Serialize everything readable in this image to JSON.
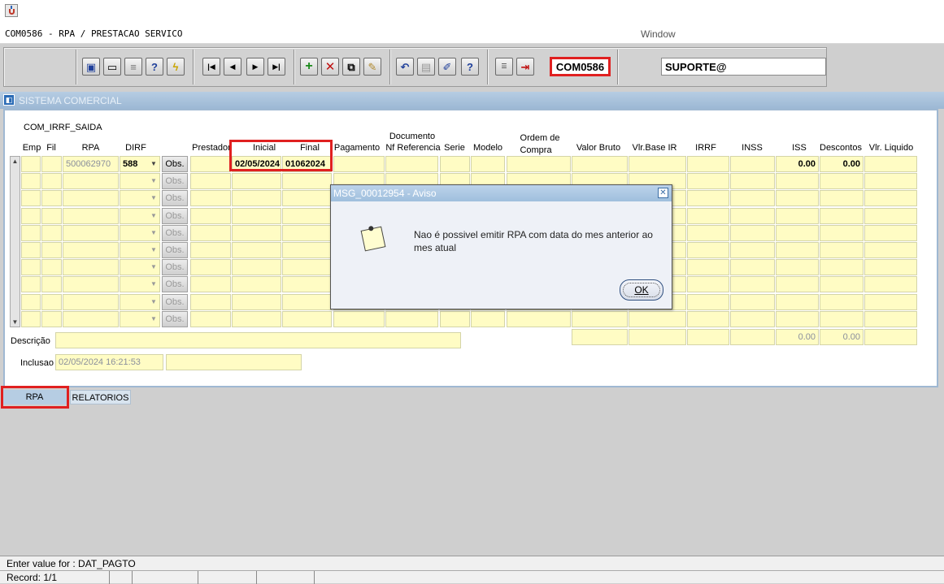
{
  "window": {
    "form_title": "COM0586 - RPA / PRESTACAO SERVICO",
    "window_menu": "Window"
  },
  "toolbar": {
    "form_code": "COM0586",
    "user": "SUPORTE@"
  },
  "system": {
    "title": "SISTEMA COMERCIAL"
  },
  "block": {
    "name": "COM_IRRF_SAIDA",
    "headers": {
      "emp": "Emp",
      "fil": "Fil",
      "rpa": "RPA",
      "dirf": "DIRF",
      "prestador": "Prestador",
      "inicial": "Inicial",
      "final": "Final",
      "pagamento": "Pagamento",
      "documento": "Documento",
      "nf_referencia": "Nf Referencia",
      "serie": "Serie",
      "modelo": "Modelo",
      "ordem_de": "Ordem de",
      "compra": "Compra",
      "valor_bruto": "Valor Bruto",
      "vlr_base_ir": "Vlr.Base IR",
      "irrf": "IRRF",
      "inss": "INSS",
      "iss": "ISS",
      "descontos": "Descontos",
      "vlr_liquido": "Vlr. Liquido"
    },
    "row1": {
      "rpa": "500062970",
      "dirf": "588",
      "obs": "Obs.",
      "inicial": "02/05/2024",
      "final": "01062024",
      "iss": "0.00",
      "descontos": "0.00"
    },
    "obs_label": "Obs.",
    "totals": {
      "iss": "0.00",
      "descontos": "0.00"
    },
    "descricao_label": "Descrição",
    "inclusao_label": "Inclusao",
    "inclusao_value": "02/05/2024 16:21:53"
  },
  "dialog": {
    "title": "MSG_00012954 - Aviso",
    "message": "Nao é possivel emitir RPA com data do mes anterior ao mes atual",
    "ok": "OK"
  },
  "tabs": [
    {
      "label": "RPA"
    },
    {
      "label": "RELATORIOS"
    }
  ],
  "status": {
    "message": "Enter value for : DAT_PAGTO",
    "record": "Record: 1/1"
  },
  "colors": {
    "field_bg": "#fffcc4",
    "highlight": "#e02020",
    "title_blue": "#9cb8d4"
  }
}
